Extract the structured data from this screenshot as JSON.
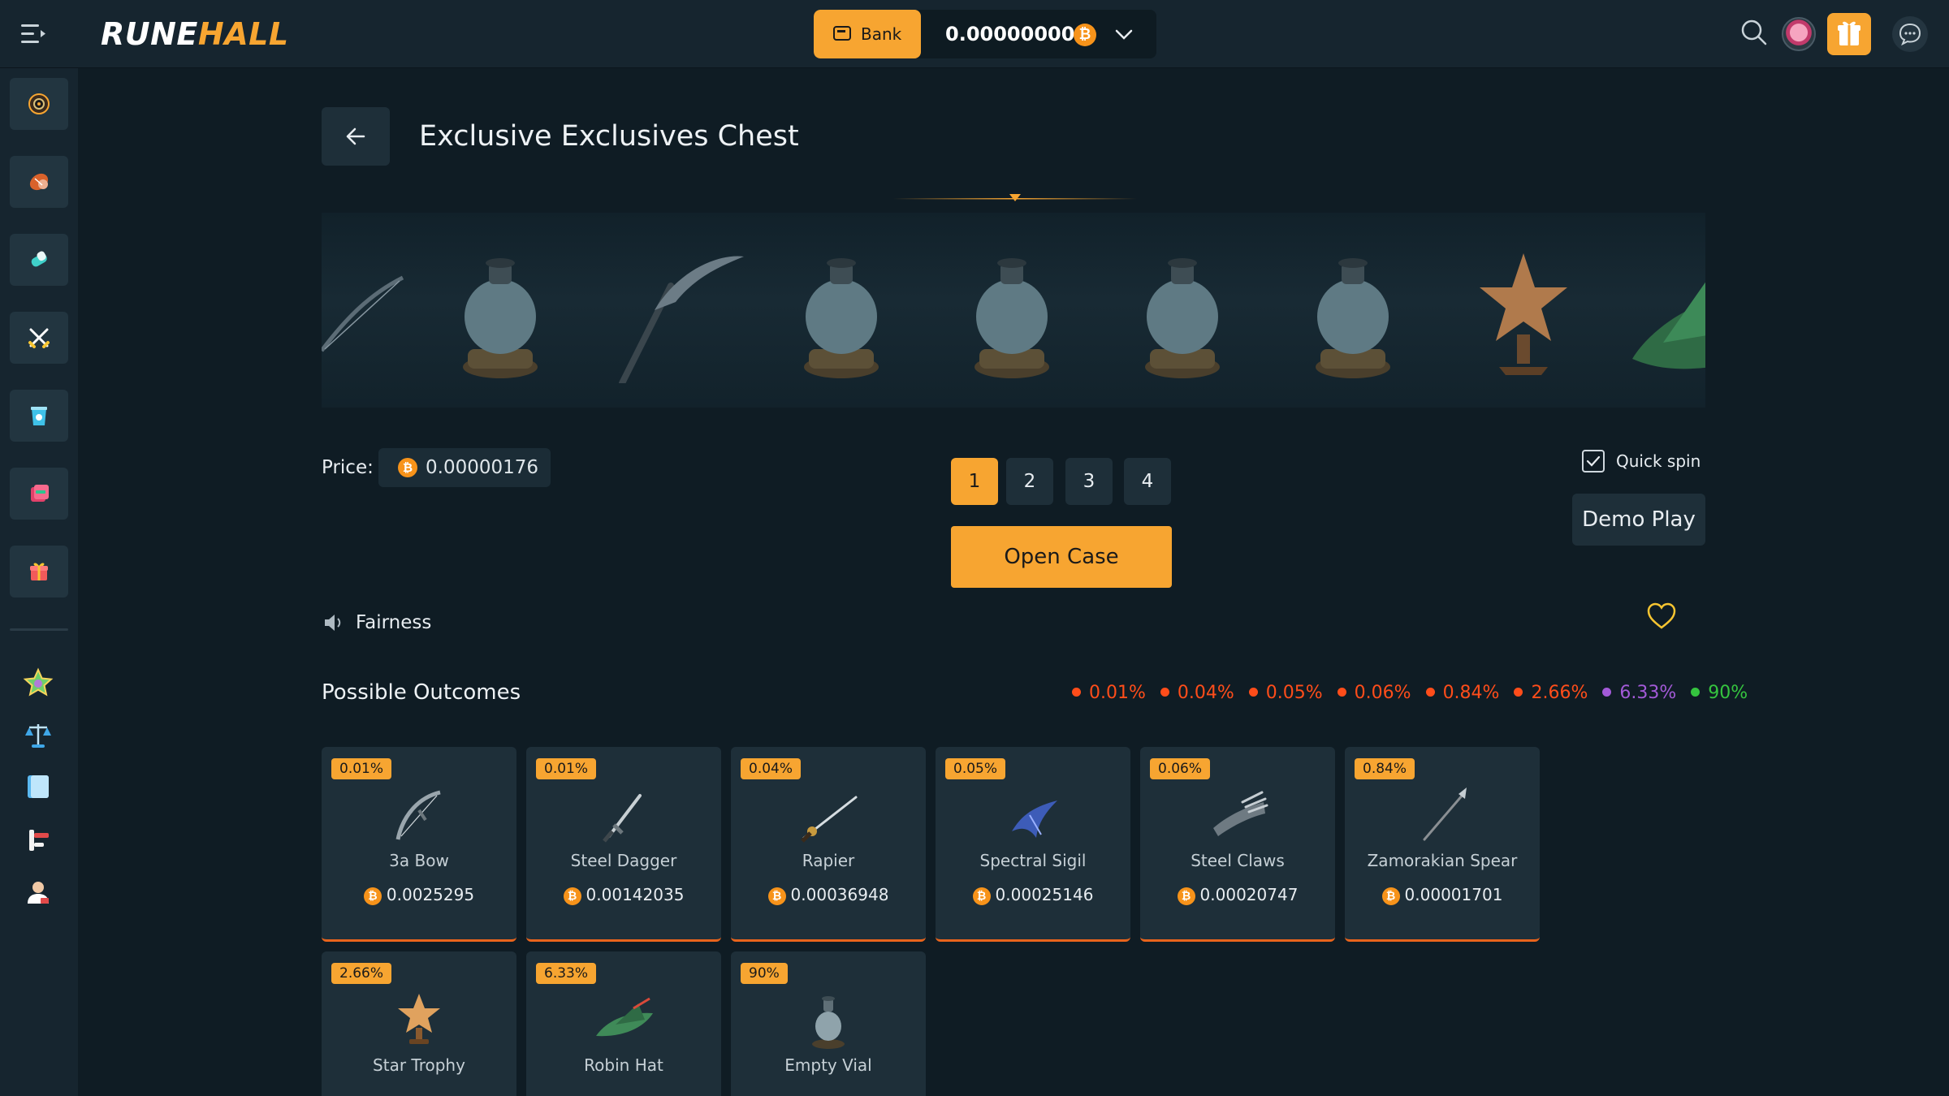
{
  "brand": {
    "logo_part1": "RUNE",
    "logo_part2": "HALL"
  },
  "header": {
    "bank_label": "Bank",
    "balance": "0.00000000",
    "currency_symbol": "₿"
  },
  "page": {
    "title": "Exclusive Exclusives Chest"
  },
  "price": {
    "label": "Price:",
    "value": "0.00000176"
  },
  "quantity": {
    "options": [
      "1",
      "2",
      "3",
      "4"
    ],
    "selected": "1"
  },
  "actions": {
    "open_case": "Open Case",
    "quick_spin": "Quick spin",
    "quick_spin_checked": true,
    "demo_play": "Demo Play",
    "fairness": "Fairness"
  },
  "outcomes": {
    "title": "Possible Outcomes",
    "legend": [
      {
        "label": "0.01%",
        "color": "#ff4d1a"
      },
      {
        "label": "0.04%",
        "color": "#ff4d1a"
      },
      {
        "label": "0.05%",
        "color": "#ff4d1a"
      },
      {
        "label": "0.06%",
        "color": "#ff4d1a"
      },
      {
        "label": "0.84%",
        "color": "#ff4d1a"
      },
      {
        "label": "2.66%",
        "color": "#ff4d1a"
      },
      {
        "label": "6.33%",
        "color": "#a35ad8"
      },
      {
        "label": "90%",
        "color": "#35c43f"
      }
    ],
    "items": [
      {
        "chance": "0.01%",
        "name": "3a Bow",
        "price": "0.0025295",
        "icon": "bow-icon"
      },
      {
        "chance": "0.01%",
        "name": "Steel Dagger",
        "price": "0.00142035",
        "icon": "dagger-icon"
      },
      {
        "chance": "0.04%",
        "name": "Rapier",
        "price": "0.00036948",
        "icon": "rapier-icon"
      },
      {
        "chance": "0.05%",
        "name": "Spectral Sigil",
        "price": "0.00025146",
        "icon": "sigil-icon"
      },
      {
        "chance": "0.06%",
        "name": "Steel Claws",
        "price": "0.00020747",
        "icon": "claws-icon"
      },
      {
        "chance": "0.84%",
        "name": "Zamorakian Spear",
        "price": "0.00001701",
        "icon": "spear-icon"
      },
      {
        "chance": "2.66%",
        "name": "Star Trophy",
        "price": "",
        "icon": "trophy-icon"
      },
      {
        "chance": "6.33%",
        "name": "Robin Hat",
        "price": "",
        "icon": "hat-icon"
      },
      {
        "chance": "90%",
        "name": "Empty Vial",
        "price": "",
        "icon": "vial-icon"
      }
    ]
  },
  "colors": {
    "accent": "#f7a531",
    "background": "#0f1c24",
    "panel": "#1e2f39",
    "rarity_border": "#e8641c"
  }
}
